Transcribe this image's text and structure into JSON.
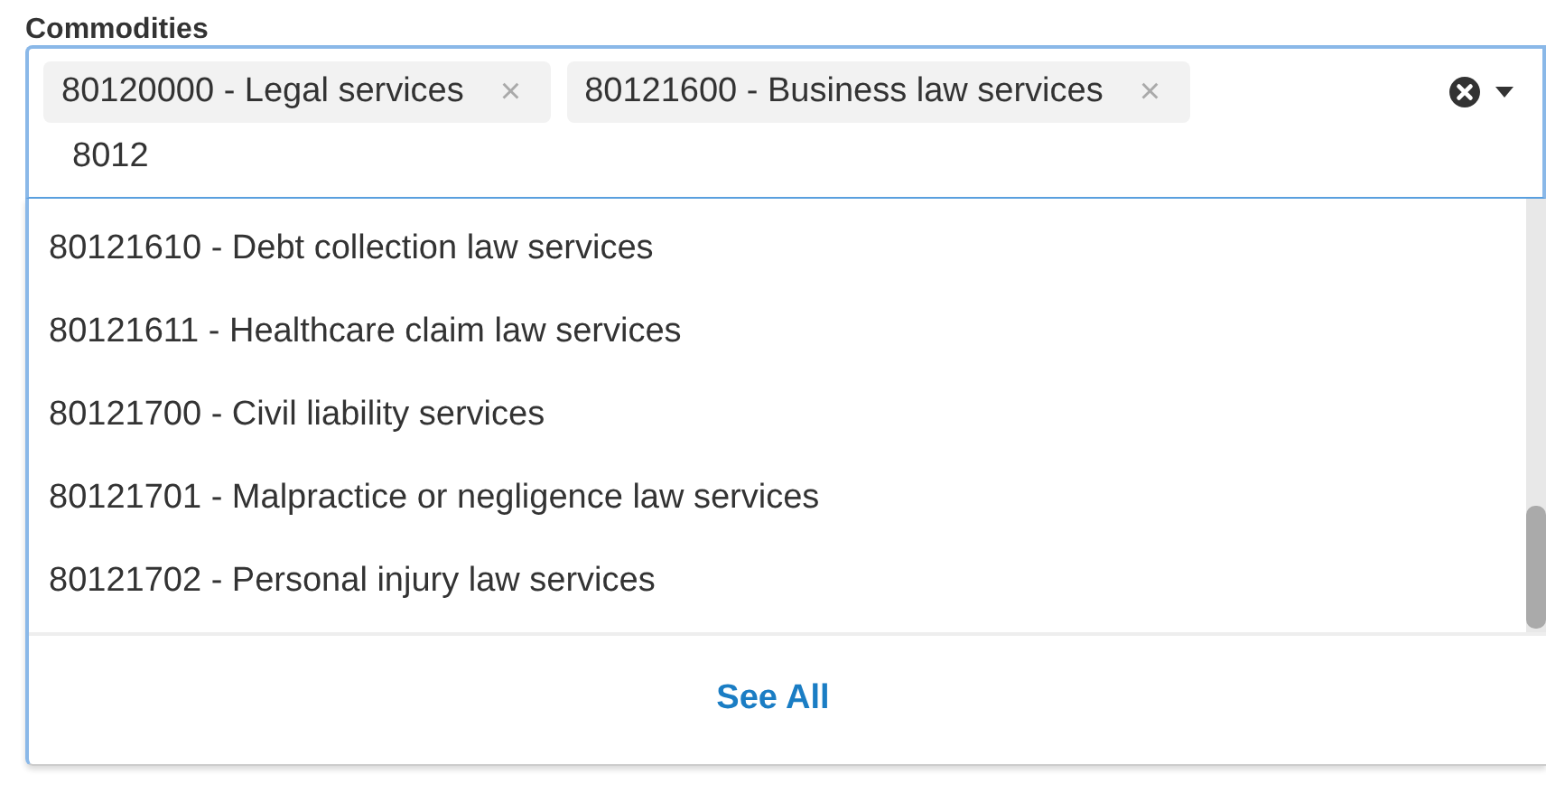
{
  "field": {
    "label": "Commodities",
    "value": "8012",
    "tags": [
      {
        "label": "80120000 - Legal services",
        "remove": "×"
      },
      {
        "label": "80121600 - Business law services",
        "remove": "×"
      }
    ]
  },
  "dropdown": {
    "options": [
      {
        "label": "80121610 - Debt collection law services",
        "selected": false
      },
      {
        "label": "80121611 - Healthcare claim law services",
        "selected": false
      },
      {
        "label": "80121700 - Civil liability services",
        "selected": false
      },
      {
        "label": "80121701 - Malpractice or negligence law services",
        "selected": false
      },
      {
        "label": "80121702 - Personal injury law services",
        "selected": false
      }
    ],
    "footer_link": "See All"
  }
}
